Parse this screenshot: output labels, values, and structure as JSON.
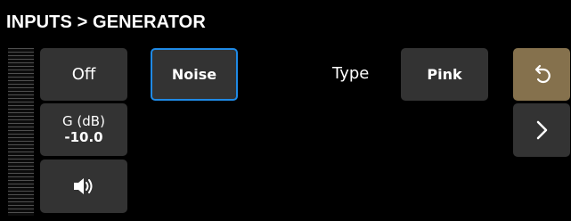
{
  "header": {
    "title": "INPUTS > GENERATOR"
  },
  "controls": {
    "off_label": "Off",
    "gain_label": "G (dB)",
    "gain_value": "-10.0",
    "speaker_icon": "speaker-icon",
    "noise_label": "Noise",
    "noise_selected": true,
    "type_label": "Type",
    "type_value": "Pink"
  },
  "navigation": {
    "undo_icon": "undo-icon",
    "next_icon": "chevron-right-icon"
  },
  "colors": {
    "background": "#000000",
    "button": "#333333",
    "selected_border": "#1f8ae6",
    "undo_button": "#85714d"
  }
}
